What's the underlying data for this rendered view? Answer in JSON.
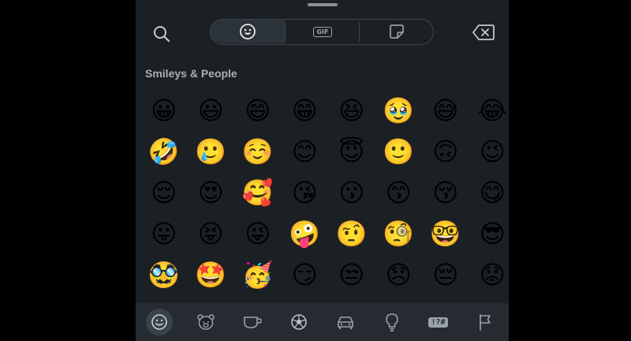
{
  "section_title": "Smileys & People",
  "tabs": [
    {
      "name": "emoji-tab",
      "icon": "smiley-icon",
      "active": true
    },
    {
      "name": "gif-tab",
      "label": "GIF",
      "icon": "gif-icon",
      "active": false
    },
    {
      "name": "sticker-tab",
      "icon": "sticker-icon",
      "active": false
    }
  ],
  "emojis": [
    "😀",
    "😃",
    "😄",
    "😁",
    "😆",
    "🥹",
    "😅",
    "😂",
    "🤣",
    "🥲",
    "☺️",
    "😊",
    "😇",
    "🙂",
    "🙃",
    "😉",
    "😌",
    "😍",
    "🥰",
    "😘",
    "😗",
    "😙",
    "😚",
    "😋",
    "😛",
    "😝",
    "😜",
    "🤪",
    "🤨",
    "🧐",
    "🤓",
    "😎",
    "🥸",
    "🤩",
    "🥳",
    "😏",
    "😒",
    "😞",
    "😔",
    "😟"
  ],
  "categories": [
    {
      "name": "smileys",
      "icon": "smiley-icon",
      "active": true
    },
    {
      "name": "animals",
      "icon": "bear-icon",
      "active": false
    },
    {
      "name": "food",
      "icon": "cup-icon",
      "active": false
    },
    {
      "name": "activities",
      "icon": "soccer-ball-icon",
      "active": false
    },
    {
      "name": "travel",
      "icon": "car-icon",
      "active": false
    },
    {
      "name": "objects",
      "icon": "lightbulb-icon",
      "active": false
    },
    {
      "name": "symbols",
      "icon": "symbols-icon",
      "label": "!?#",
      "active": false
    },
    {
      "name": "flags",
      "icon": "flag-icon",
      "active": false
    }
  ],
  "colors": {
    "panel": "#1b2025",
    "icon": "#b8bec4",
    "border": "#3e464e"
  }
}
